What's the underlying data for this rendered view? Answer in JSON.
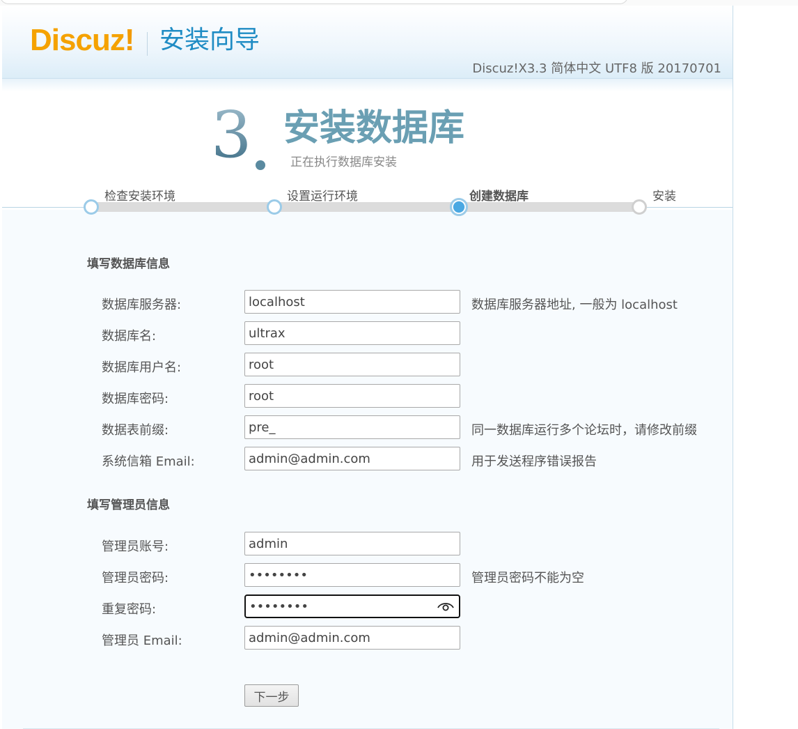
{
  "header": {
    "logo_text": "Discuz",
    "logo_bang": "!",
    "wizard_title": "安装向导",
    "version": "Discuz!X3.3 简体中文 UTF8 版 20170701"
  },
  "step": {
    "number": "3",
    "title": "安装数据库",
    "subtitle": "正在执行数据库安装"
  },
  "progress": {
    "steps": [
      {
        "label": "检查安装环境",
        "state": "done"
      },
      {
        "label": "设置运行环境",
        "state": "done"
      },
      {
        "label": "创建数据库",
        "state": "current"
      },
      {
        "label": "安装",
        "state": "todo"
      }
    ]
  },
  "db_section": {
    "title": "填写数据库信息",
    "fields": [
      {
        "label": "数据库服务器:",
        "value": "localhost",
        "hint": "数据库服务器地址, 一般为 localhost"
      },
      {
        "label": "数据库名:",
        "value": "ultrax",
        "hint": ""
      },
      {
        "label": "数据库用户名:",
        "value": "root",
        "hint": ""
      },
      {
        "label": "数据库密码:",
        "value": "root",
        "hint": ""
      },
      {
        "label": "数据表前缀:",
        "value": "pre_",
        "hint": "同一数据库运行多个论坛时，请修改前缀"
      },
      {
        "label": "系统信箱 Email:",
        "value": "admin@admin.com",
        "hint": "用于发送程序错误报告"
      }
    ]
  },
  "admin_section": {
    "title": "填写管理员信息",
    "fields": [
      {
        "label": "管理员账号:",
        "value": "admin",
        "hint": ""
      },
      {
        "label": "管理员密码:",
        "value": "••••••••",
        "hint": "管理员密码不能为空"
      },
      {
        "label": "重复密码:",
        "value": "••••••••",
        "hint": ""
      },
      {
        "label": "管理员 Email:",
        "value": "admin@admin.com",
        "hint": ""
      }
    ]
  },
  "next_button": "下一步",
  "colors": {
    "logo": "#f5a200",
    "wizard_title": "#1f8cc4",
    "step_title": "#6a9fb3",
    "progress_node": "#9bcbe8",
    "progress_current": "#4aa8e2"
  }
}
